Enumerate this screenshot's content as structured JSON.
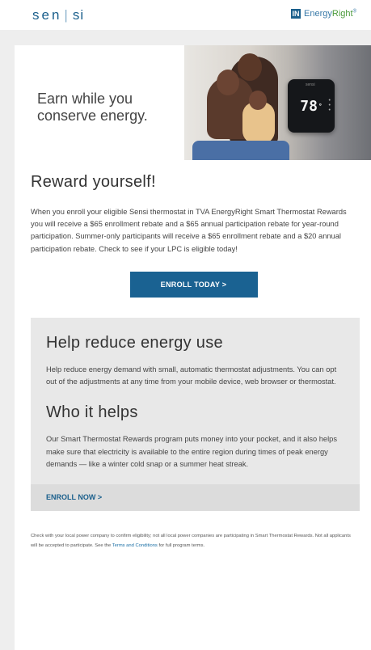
{
  "header": {
    "sensi_logo": "sen",
    "sensi_logo_2": "si",
    "energyright_mark": "IN",
    "energyright_text_a": "Energy",
    "energyright_text_b": "Right",
    "energyright_reg": "®"
  },
  "hero": {
    "headline_line1": "Earn while you",
    "headline_line2": "conserve energy.",
    "thermostat_temp": "78",
    "thermostat_unit": "°"
  },
  "reward": {
    "title": "Reward yourself!",
    "body": "When you enroll your eligible Sensi thermostat in TVA EnergyRight Smart Thermostat Rewards you will receive a $65 enrollment rebate and a $65 annual participation rebate for year-round participation. Summer-only participants will receive a $65 enrollment rebate and a $20 annual participation rebate. Check to see if your LPC is eligible today!",
    "button_label": "ENROLL TODAY >"
  },
  "help": {
    "title": "Help reduce energy use",
    "body": "Help reduce energy demand with small, automatic thermostat adjustments. You can opt out of the adjustments at any time from your mobile device, web browser or thermostat."
  },
  "who": {
    "title": "Who it helps",
    "body": "Our Smart Thermostat Rewards program puts money into your pocket, and it also helps make sure that electricity is available to the entire region during times of peak energy demands — like a winter cold snap or a summer heat streak.",
    "link_label": "ENROLL NOW >"
  },
  "footnote": {
    "text_before": "Check with your local power company to confirm eligibility; not all local power companies are participating in Smart Thermostat Rewards. Not all applicants will be accepted to participate. See the ",
    "link": "Terms and Conditions",
    "text_after": " for full program terms."
  },
  "colors": {
    "brand_blue": "#1a6292",
    "page_bg": "#eeeeee",
    "panel_grey": "#e8e8e8"
  }
}
